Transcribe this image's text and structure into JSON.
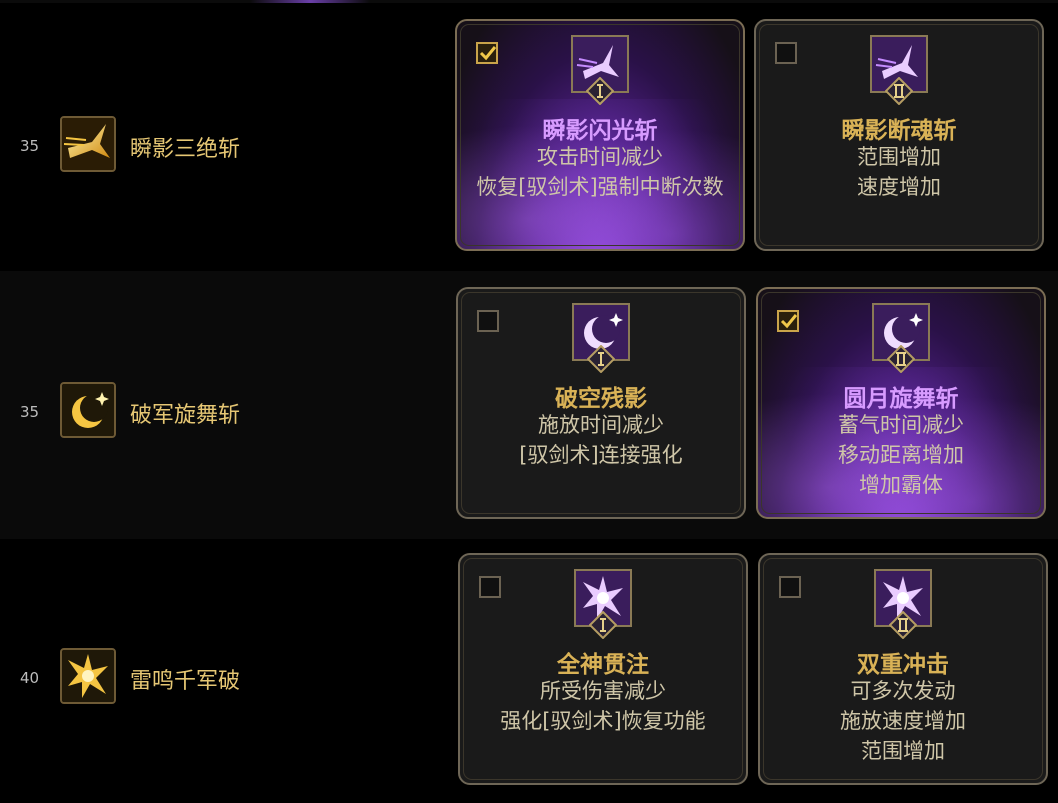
{
  "colors": {
    "accent_gold": "#e6c774",
    "selected_title": "#d79bff",
    "panel_border": "#6e6656"
  },
  "skills": [
    {
      "level": "35",
      "name": "瞬影三绝斩",
      "icon": "sword-swoosh-icon",
      "options": [
        {
          "roman": "I",
          "title": "瞬影闪光斩",
          "lines": [
            "攻击时间减少",
            "恢复[驭剑术]强制中断次数"
          ],
          "selected": true,
          "icon": "phantom-bird-icon"
        },
        {
          "roman": "II",
          "title": "瞬影断魂斩",
          "lines": [
            "范围增加",
            "速度增加"
          ],
          "selected": false,
          "icon": "phantom-bird-icon"
        }
      ]
    },
    {
      "level": "35",
      "name": "破军旋舞斩",
      "icon": "crescent-moon-icon",
      "options": [
        {
          "roman": "I",
          "title": "破空残影",
          "lines": [
            "施放时间减少",
            "[驭剑术]连接强化"
          ],
          "selected": false,
          "icon": "crescent-moon-icon"
        },
        {
          "roman": "II",
          "title": "圆月旋舞斩",
          "lines": [
            "蓄气时间减少",
            "移动距离增加",
            "增加霸体"
          ],
          "selected": true,
          "icon": "crescent-moon-icon"
        }
      ]
    },
    {
      "level": "40",
      "name": "雷鸣千军破",
      "icon": "lightning-burst-icon",
      "options": [
        {
          "roman": "I",
          "title": "全神贯注",
          "lines": [
            "所受伤害减少",
            "强化[驭剑术]恢复功能"
          ],
          "selected": false,
          "icon": "lightning-burst-icon"
        },
        {
          "roman": "II",
          "title": "双重冲击",
          "lines": [
            "可多次发动",
            "施放速度增加",
            "范围增加"
          ],
          "selected": false,
          "icon": "lightning-burst-icon"
        }
      ]
    }
  ]
}
